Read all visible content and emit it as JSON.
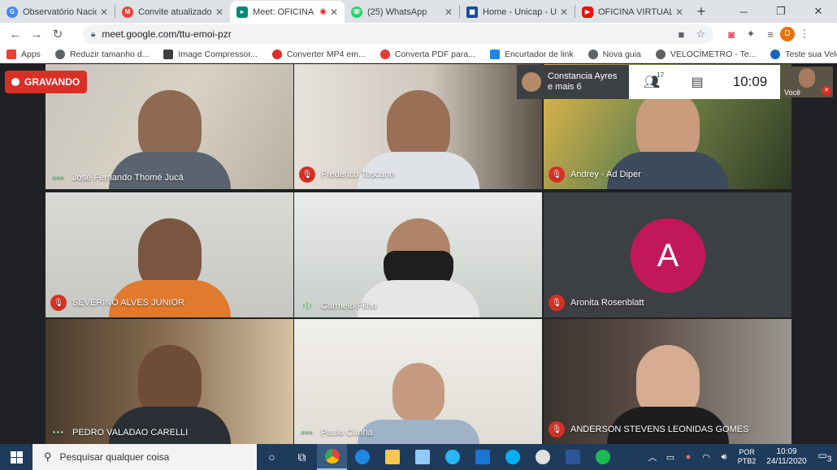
{
  "browser": {
    "tabs": [
      {
        "title": "Observatório Nacion",
        "icon": "google-icon",
        "color": "#4285f4",
        "active": false
      },
      {
        "title": "Convite atualizado: C",
        "icon": "gmail-icon",
        "color": "#ea4335",
        "active": false
      },
      {
        "title": "Meet: OFICINA V",
        "icon": "meet-icon",
        "color": "#00897b",
        "active": true
      },
      {
        "title": "(25) WhatsApp",
        "icon": "whatsapp-icon",
        "color": "#25d366",
        "active": false
      },
      {
        "title": "Home - Unicap - Uni",
        "icon": "unicap-icon",
        "color": "#1a4b9c",
        "active": false
      },
      {
        "title": "OFICINA VIRTUAL IN",
        "icon": "youtube-icon",
        "color": "#ff0000",
        "active": false
      }
    ],
    "url": "meet.google.com/ttu-emoi-pzr",
    "profile_initial": "D",
    "bookmarks": [
      {
        "label": "Apps",
        "color": "#ea4335"
      },
      {
        "label": "Reduzir tamanho d...",
        "color": "#5f6368"
      },
      {
        "label": "Image Compressor...",
        "color": "#3c4043"
      },
      {
        "label": "Converter MP4 em...",
        "color": "#d93025"
      },
      {
        "label": "Converta PDF para...",
        "color": "#e53935"
      },
      {
        "label": "Encurtador de link",
        "color": "#1e88e5"
      },
      {
        "label": "Nova guia",
        "color": "#5f6368"
      },
      {
        "label": "VELOCÍMETRO - Te...",
        "color": "#616161"
      },
      {
        "label": "Teste sua Velocidad...",
        "color": "#1565c0"
      }
    ]
  },
  "meet": {
    "recording_label": "GRAVANDO",
    "presenter_line1": "Constancia Ayres",
    "presenter_line2": "e mais 6",
    "participant_count": "17",
    "time": "10:09",
    "self_label": "Você",
    "participants": [
      {
        "name": "José Fernando Thomé Jucá",
        "status": "speaking-dots"
      },
      {
        "name": "Frederico Toscano",
        "status": "muted"
      },
      {
        "name": "Andrey - Ad Diper",
        "status": "muted"
      },
      {
        "name": "SEVERINO ALVES JUNIOR",
        "status": "muted"
      },
      {
        "name": "Carmelo Filho",
        "status": "audio-bars"
      },
      {
        "name": "Aronita Rosenblatt",
        "status": "muted",
        "avatar_letter": "A"
      },
      {
        "name": "PEDRO VALADAO CARELLI",
        "status": "speaking-dots"
      },
      {
        "name": "Paulo Cunha",
        "status": "speaking-dots"
      },
      {
        "name": "ANDERSON STEVENS LEONIDAS GOMES",
        "status": "muted"
      }
    ]
  },
  "taskbar": {
    "search_placeholder": "Pesquisar qualquer coisa",
    "lang_line1": "POR",
    "lang_line2": "PTB2",
    "clock_time": "10:09",
    "clock_date": "24/11/2020",
    "notification_count": "3"
  }
}
